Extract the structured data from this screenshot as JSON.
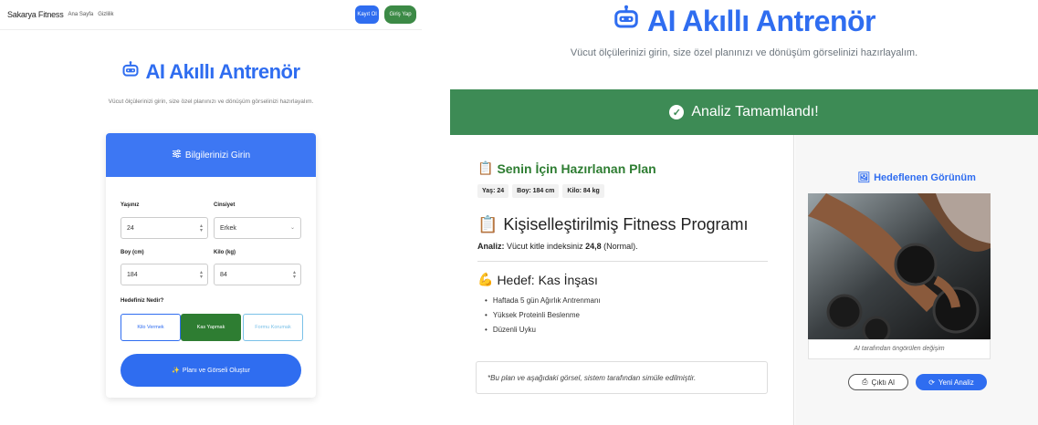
{
  "left": {
    "navbar": {
      "brand": "Sakarya Fitness",
      "links": [
        "Ana Sayfa",
        "Gizlilik"
      ],
      "register_label": "Kayıt Ol",
      "login_label": "Giriş Yap"
    },
    "title": "AI Akıllı Antrenör",
    "subtitle": "Vücut ölçülerinizi girin, size özel planınızı ve dönüşüm görselinizi hazırlayalım.",
    "form": {
      "header": "Bilgilerinizi Girin",
      "age_label": "Yaşınız",
      "age_value": "24",
      "gender_label": "Cinsiyet",
      "gender_value": "Erkek",
      "height_label": "Boy (cm)",
      "height_value": "184",
      "weight_label": "Kilo (kg)",
      "weight_value": "84",
      "goal_label": "Hedefiniz Nedir?",
      "goals": [
        "Kilo Vermek",
        "Kas Yapmak",
        "Formu Korumak"
      ],
      "selected_goal": "Kas Yapmak",
      "submit_label": "Planı ve Görseli Oluştur"
    }
  },
  "right": {
    "title": "AI Akıllı Antrenör",
    "subtitle": "Vücut ölçülerinizi girin, size özel planınızı ve dönüşüm görselinizi hazırlayalım.",
    "banner": "Analiz Tamamlandı!",
    "plan": {
      "header": "Senin İçin Hazırlanan Plan",
      "tags": [
        "Yaş: 24",
        "Boy: 184 cm",
        "Kilo: 84 kg"
      ],
      "program_title": "Kişiselleştirilmiş Fitness Programı",
      "analysis_label": "Analiz:",
      "analysis_text": "Vücut kitle indeksiniz",
      "bmi_value": "24,8",
      "bmi_category": "(Normal).",
      "goal_heading": "Hedef: Kas İnşası",
      "bullets": [
        "Haftada 5 gün Ağırlık Antrenmanı",
        "Yüksek Proteinli Beslenme",
        "Düzenli Uyku"
      ],
      "note": "*Bu plan ve aşağıdaki görsel, sistem tarafından simüle edilmiştir."
    },
    "visual": {
      "title": "Hedeflenen Görünüm",
      "caption": "AI tarafından öngörülen değişim",
      "print_label": "Çıktı Al",
      "new_label": "Yeni Analiz"
    }
  },
  "colors": {
    "primary": "#2f6df0",
    "success": "#3d8b55",
    "goal_selected": "#2e7d32"
  },
  "icons": [
    "robot-icon",
    "sliders-icon",
    "check-circle-icon",
    "clipboard-icon",
    "flexed-biceps-icon",
    "image-icon",
    "printer-icon",
    "refresh-icon",
    "magic-icon"
  ]
}
